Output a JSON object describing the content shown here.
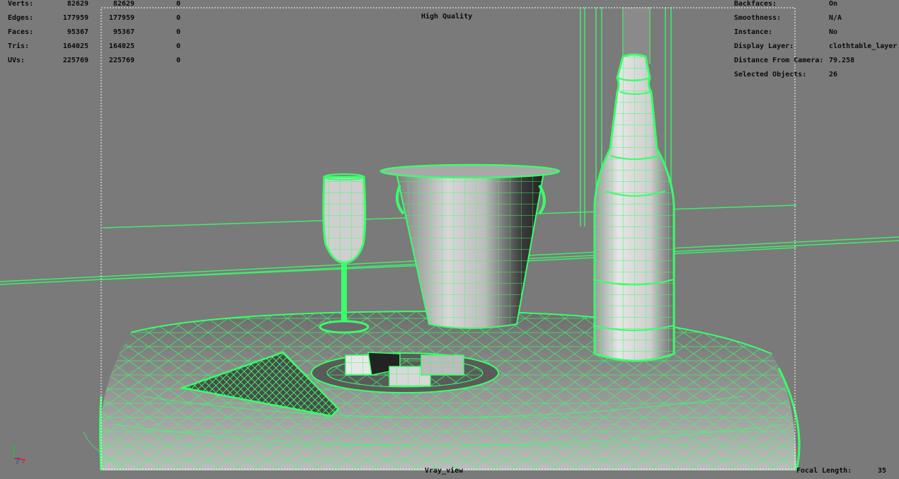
{
  "poly_count": {
    "rows": [
      {
        "label": "Verts:",
        "total": "82629",
        "selected": "82629",
        "components": "0"
      },
      {
        "label": "Edges:",
        "total": "177959",
        "selected": "177959",
        "components": "0"
      },
      {
        "label": "Faces:",
        "total": "95367",
        "selected": "95367",
        "components": "0"
      },
      {
        "label": "Tris:",
        "total": "164025",
        "selected": "164025",
        "components": "0"
      },
      {
        "label": "UVs:",
        "total": "225769",
        "selected": "225769",
        "components": "0"
      }
    ]
  },
  "viewport": {
    "quality_label": "High Quality",
    "camera_name": "Vray_view",
    "focal_length_label": "Focal Length:",
    "focal_length_value": "35"
  },
  "object_details": {
    "rows": [
      {
        "label": "Backfaces:",
        "value": "On"
      },
      {
        "label": "Smoothness:",
        "value": "N/A"
      },
      {
        "label": "Instance:",
        "value": "No"
      },
      {
        "label": "Display Layer:",
        "value": "clothtable_layer"
      },
      {
        "label": "Distance From Camera:",
        "value": "79.258"
      },
      {
        "label": "Selected Objects:",
        "value": "26"
      }
    ]
  },
  "axis_gizmo": {
    "y_label": "y",
    "z_label": "z",
    "x_label": "x"
  },
  "colors": {
    "background": "#7a7a7a",
    "wireframe": "#39ff6a",
    "hud_text": "#0b0b0b",
    "axis_x": "#d12020",
    "axis_y": "#20c040",
    "axis_z": "#2040d0"
  }
}
